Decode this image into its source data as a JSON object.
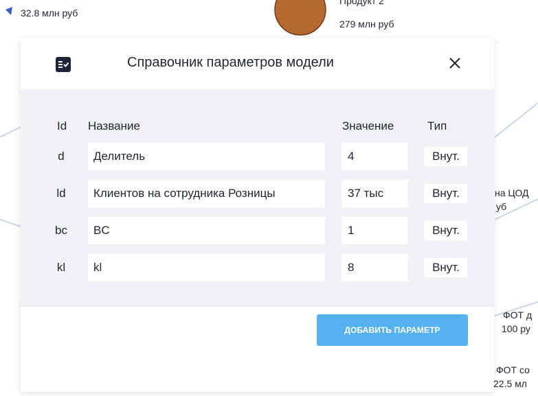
{
  "background": {
    "labels": [
      {
        "text": "32.8 млн руб"
      },
      {
        "text": "Продукт 2"
      },
      {
        "text": "279 млн руб"
      },
      {
        "text": "на ЦОД"
      },
      {
        "text": "уб"
      },
      {
        "text": "ФОТ д"
      },
      {
        "text": "100 ру"
      },
      {
        "text": "ФОТ со"
      },
      {
        "text": "22.5 мл"
      }
    ],
    "colors": {
      "node": "#b5682f",
      "edge": "#c9d7ea",
      "arrow": "#3a5bc7"
    }
  },
  "modal": {
    "icon": "list-check-icon",
    "title": "Справочник параметров модели",
    "close_icon": "close-icon",
    "columns": {
      "id": "Id",
      "name": "Название",
      "value": "Значение",
      "type": "Тип"
    },
    "rows": [
      {
        "id": "d",
        "name": "Делитель",
        "value": "4",
        "type": "Внут."
      },
      {
        "id": "ld",
        "name": "Клиентов на сотрудника Розницы",
        "value": "37 тыс",
        "type": "Внут."
      },
      {
        "id": "bc",
        "name": "BC",
        "value": "1",
        "type": "Внут."
      },
      {
        "id": "kl",
        "name": "kl",
        "value": "8",
        "type": "Внут."
      }
    ],
    "add_button": "ДОБАВИТЬ ПАРАМЕТР",
    "colors": {
      "accent": "#56b2ef",
      "body_bg": "#f1f2f5",
      "text": "#1f2430"
    }
  }
}
